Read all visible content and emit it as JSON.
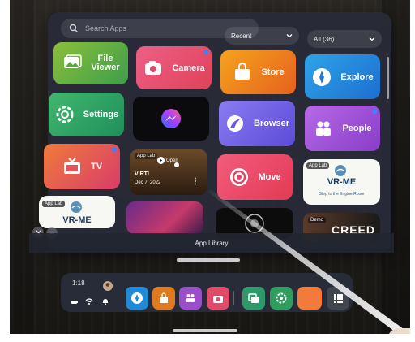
{
  "search": {
    "placeholder": "Search Apps"
  },
  "filters": {
    "sort": "Recent",
    "category": "All (36)"
  },
  "apps": [
    {
      "label": "File\nViewer",
      "icon": "image-icon"
    },
    {
      "label": "Camera",
      "icon": "camera-icon"
    },
    {
      "label": "Store",
      "icon": "store-bag-icon"
    },
    {
      "label": "Explore",
      "icon": "compass-icon"
    },
    {
      "label": "Settings",
      "icon": "gear-icon"
    },
    {
      "label": "",
      "icon": "messenger-icon"
    },
    {
      "label": "Browser",
      "icon": "browser-icon"
    },
    {
      "label": "People",
      "icon": "people-icon"
    },
    {
      "label": "TV",
      "icon": "tv-icon"
    },
    {
      "label": "Move",
      "icon": "move-icon"
    }
  ],
  "virti": {
    "badge": "App Lab",
    "open_label": "Open",
    "name": "VIRTI",
    "date": "Dec 7, 2022",
    "more": "⋮"
  },
  "vrme1": {
    "badge": "App Lab",
    "title": "VR-ME",
    "subtitle": "Step to the Engine Room"
  },
  "vrme2": {
    "badge": "App Lab",
    "title": "VR-ME"
  },
  "creed": {
    "badge": "Demo",
    "title": "CREED"
  },
  "library_title": "App Library",
  "dock": {
    "time": "1:18",
    "colors": {
      "explore": "#1f8ad6",
      "store": "#e07a1e",
      "people": "#9a4fc9",
      "camera": "#e34a6a",
      "multitask": "#2e9a6b",
      "settings": "#2f9d5e",
      "orange": "#f07b3a"
    }
  }
}
